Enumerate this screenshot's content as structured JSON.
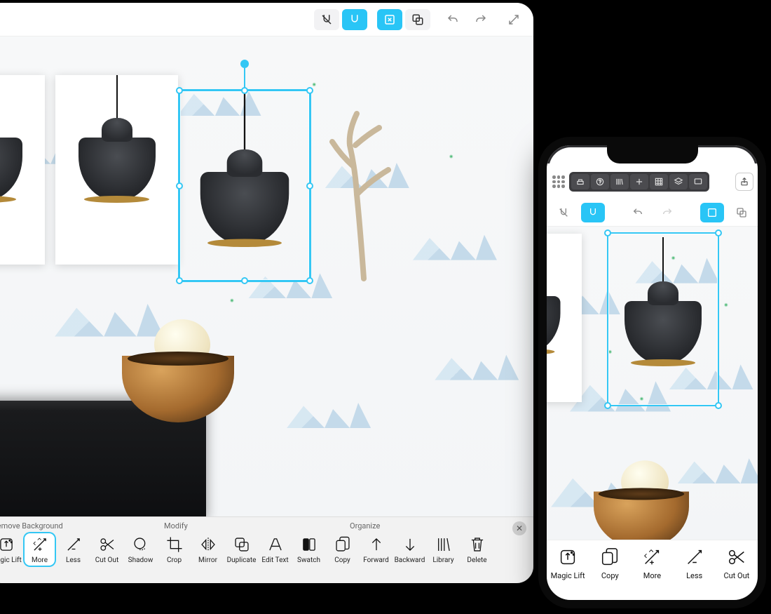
{
  "colors": {
    "accent": "#29c5f6",
    "selection": "#34c7f4"
  },
  "tablet": {
    "top_tools": {
      "magnet_off": "magnet-off",
      "magnet_on": "magnet-on",
      "bounds": "bounding-box",
      "group": "group",
      "undo": "undo",
      "redo": "redo",
      "expand": "fullscreen"
    },
    "sections": {
      "a": "Remove Background",
      "b": "Modify",
      "c": "Organize"
    },
    "items": [
      {
        "id": "magiclift",
        "label": "Magic Lift"
      },
      {
        "id": "more",
        "label": "More",
        "selected": true
      },
      {
        "id": "less",
        "label": "Less"
      },
      {
        "id": "cutout",
        "label": "Cut Out"
      },
      {
        "id": "shadow",
        "label": "Shadow"
      },
      {
        "id": "crop",
        "label": "Crop"
      },
      {
        "id": "mirror",
        "label": "Mirror"
      },
      {
        "id": "duplicate",
        "label": "Duplicate"
      },
      {
        "id": "edittext",
        "label": "Edit Text"
      },
      {
        "id": "swatch",
        "label": "Swatch"
      },
      {
        "id": "copy",
        "label": "Copy"
      },
      {
        "id": "forward",
        "label": "Forward"
      },
      {
        "id": "backward",
        "label": "Backward"
      },
      {
        "id": "library",
        "label": "Library"
      },
      {
        "id": "delete",
        "label": "Delete"
      }
    ]
  },
  "phone": {
    "items": [
      {
        "id": "magiclift",
        "label": "Magic Lift"
      },
      {
        "id": "copy",
        "label": "Copy"
      },
      {
        "id": "more",
        "label": "More"
      },
      {
        "id": "less",
        "label": "Less"
      },
      {
        "id": "cutout",
        "label": "Cut Out"
      }
    ]
  }
}
